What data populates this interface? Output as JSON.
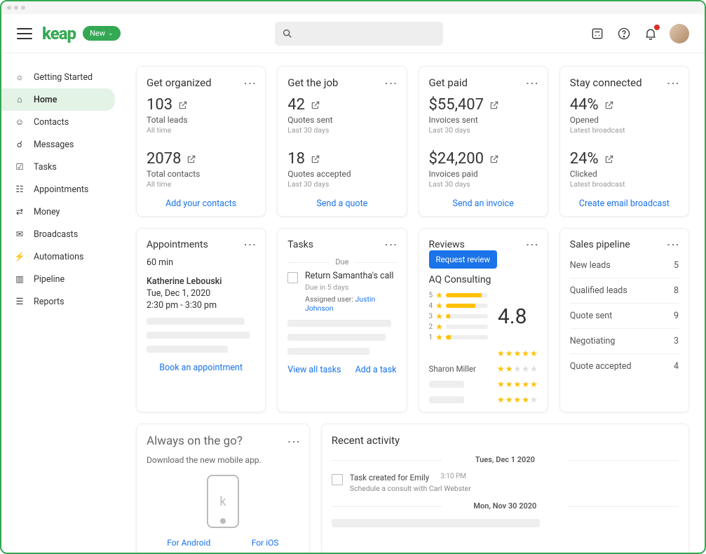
{
  "header": {
    "logo": "keap",
    "new_label": "New"
  },
  "sidebar": {
    "items": [
      "Getting Started",
      "Home",
      "Contacts",
      "Messages",
      "Tasks",
      "Appointments",
      "Money",
      "Broadcasts",
      "Automations",
      "Pipeline",
      "Reports"
    ]
  },
  "statcards": {
    "organized": {
      "title": "Get organized",
      "v1": "103",
      "l1": "Total leads",
      "m1": "All time",
      "v2": "2078",
      "l2": "Total contacts",
      "m2": "All time",
      "link": "Add your contacts"
    },
    "job": {
      "title": "Get the job",
      "v1": "42",
      "l1": "Quotes sent",
      "m1": "Last 30 days",
      "v2": "18",
      "l2": "Quotes accepted",
      "m2": "Last 30 days",
      "link": "Send a quote"
    },
    "paid": {
      "title": "Get paid",
      "v1": "$55,407",
      "l1": "Invoices sent",
      "m1": "Last 30 days",
      "v2": "$24,200",
      "l2": "Invoices paid",
      "m2": "Last 30 days",
      "link": "Send an invoice"
    },
    "connected": {
      "title": "Stay connected",
      "v1": "44%",
      "l1": "Opened",
      "m1": "Latest broadcast",
      "v2": "24%",
      "l2": "Clicked",
      "m2": "Latest broadcast",
      "link": "Create email broadcast"
    }
  },
  "appointments": {
    "title": "Appointments",
    "duration": "60 min",
    "name": "Katherine Lebouski",
    "date": "Tue, Dec 1, 2020",
    "time": "2:30 pm - 3:30 pm",
    "link": "Book an appointment"
  },
  "tasks": {
    "title": "Tasks",
    "due_label": "Due",
    "item": {
      "name": "Return Samantha's call",
      "meta": "Due in 5 days",
      "assigned_label": "Assigned user:",
      "assigned_user": "Justin Johnson"
    },
    "link_all": "View all tasks",
    "link_add": "Add a task"
  },
  "reviews": {
    "title": "Reviews",
    "button": "Request review",
    "company": "AQ Consulting",
    "score": "4.8",
    "dist": [
      {
        "n": "5",
        "w": 85
      },
      {
        "n": "4",
        "w": 70
      },
      {
        "n": "3",
        "w": 10
      },
      {
        "n": "2",
        "w": 0
      },
      {
        "n": "1",
        "w": 12
      }
    ],
    "row1_name": "Sharon Miller",
    "row1_stars": 2,
    "row2_stars": 5,
    "row3_stars": 4,
    "list_stars": 5
  },
  "pipeline": {
    "title": "Sales pipeline",
    "rows": [
      {
        "label": "New leads",
        "count": "5"
      },
      {
        "label": "Qualified leads",
        "count": "8"
      },
      {
        "label": "Quote sent",
        "count": "9"
      },
      {
        "label": "Negotiating",
        "count": "3"
      },
      {
        "label": "Quote accepted",
        "count": "4"
      }
    ]
  },
  "mobile": {
    "title": "Always on the go?",
    "sub": "Download the new mobile app.",
    "android": "For Android",
    "ios": "For iOS"
  },
  "recent": {
    "title": "Recent activity",
    "d1": "Tues, Dec 1 2020",
    "a1_title": "Task created for Emily",
    "a1_time": "3:10 PM",
    "a1_sub": "Schedule a consult with Carl Webster",
    "d2": "Mon, Nov 30 2020"
  }
}
